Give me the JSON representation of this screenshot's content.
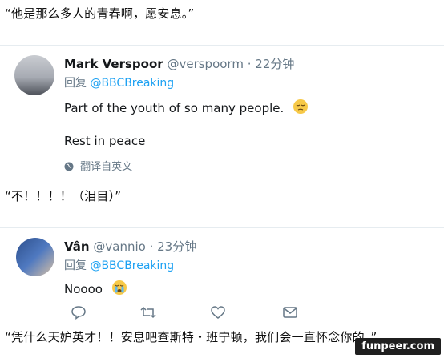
{
  "captions": {
    "first": "“他是那么多人的青春啊，愿安息。”",
    "second": "“不！！！！（泪目）”",
    "third": "“凭什么天妒英才！！安息吧查斯特・班宁顿，我们会一直怀念你的。”"
  },
  "tweet1": {
    "name": "Mark Verspoor",
    "handle": "@verspoorm",
    "time": "· 22分钟",
    "reply_prefix": "回复 ",
    "reply_to": "@BBCBreaking",
    "line1": "Part of the youth of so many people.",
    "line2": "Rest in peace",
    "translate": "翻译自英文"
  },
  "tweet2": {
    "name": "Vân",
    "handle": "@vannio",
    "time": "· 23分钟",
    "reply_prefix": "回复 ",
    "reply_to": "@BBCBreaking",
    "line1": "Noooo"
  },
  "watermark": "funpeer.com",
  "colors": {
    "link": "#1da1f2",
    "muted": "#657786",
    "text": "#14171a"
  },
  "icons": [
    "pensive-emoji",
    "crying-emoji",
    "globe-icon",
    "reply-icon",
    "retweet-icon",
    "like-icon",
    "message-icon"
  ]
}
